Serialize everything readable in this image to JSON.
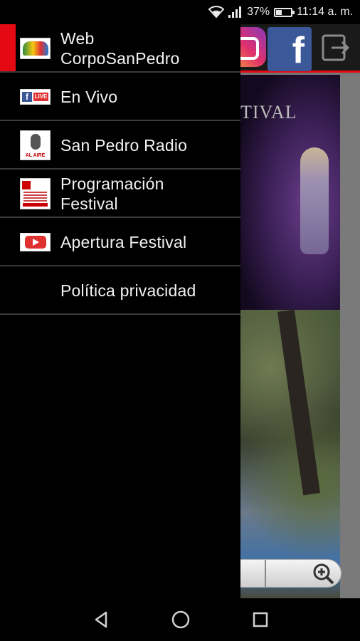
{
  "status_bar": {
    "battery_percent": "37%",
    "battery_level": 0.37,
    "time": "11:14 a. m.",
    "icons": [
      "wifi-icon",
      "signal-icon",
      "battery-icon"
    ]
  },
  "background_app": {
    "toolbar_icons": [
      "instagram-icon",
      "facebook-icon",
      "exit-icon"
    ],
    "banner_text": "TIVAL",
    "accent_color": "#e50914"
  },
  "drawer": {
    "items": [
      {
        "label_line1": "Web",
        "label_line2": "CorpoSanPedro",
        "icon": "web-corposanpedro-icon",
        "active": true
      },
      {
        "label": "En Vivo",
        "icon": "facebook-live-icon"
      },
      {
        "label": "San Pedro Radio",
        "icon": "radio-microphone-icon"
      },
      {
        "label_line1": "Programación",
        "label_line2": "Festival",
        "icon": "programacion-poster-icon"
      },
      {
        "label": "Apertura Festival",
        "icon": "youtube-icon"
      },
      {
        "label": "Política privacidad",
        "icon": ""
      }
    ]
  },
  "zoom": {
    "controls": [
      "zoom-out-icon",
      "zoom-in-icon"
    ]
  },
  "nav_bar": {
    "buttons": [
      "back-icon",
      "home-icon",
      "recents-icon"
    ]
  }
}
